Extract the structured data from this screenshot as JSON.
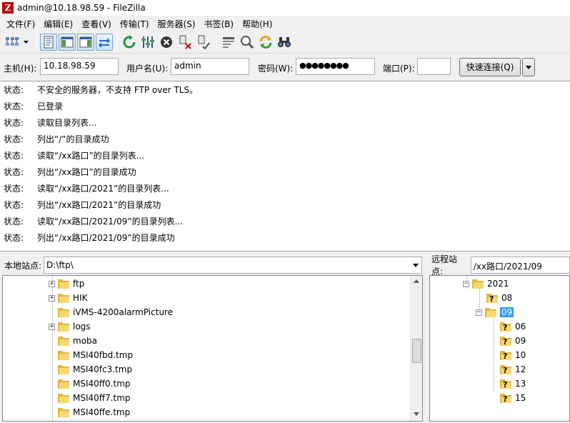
{
  "window": {
    "app_icon": "Z",
    "title": "admin@10.18.98.59 - FileZilla"
  },
  "menu": [
    {
      "label": "文件(F)"
    },
    {
      "label": "编辑(E)"
    },
    {
      "label": "查看(V)"
    },
    {
      "label": "传输(T)"
    },
    {
      "label": "服务器(S)"
    },
    {
      "label": "书签(B)"
    },
    {
      "label": "帮助(H)"
    }
  ],
  "toolbar": {
    "icons": [
      "site-manager-icon",
      "toggle-message-log-icon",
      "toggle-local-tree-icon",
      "toggle-remote-tree-icon",
      "toggle-queue-icon",
      "refresh-icon",
      "process-queue-icon",
      "cancel-icon",
      "disconnect-icon",
      "reconnect-icon",
      "filter-icon",
      "compare-icon",
      "sync-browse-icon",
      "search-icon"
    ]
  },
  "quickconnect": {
    "host_label": "主机(H):",
    "host_value": "10.18.98.59",
    "user_label": "用户名(U):",
    "user_value": "admin",
    "pass_label": "密码(W):",
    "pass_value": "●●●●●●●●",
    "port_label": "端口(P):",
    "port_value": "",
    "connect_label": "快速连接(Q)"
  },
  "log": [
    {
      "type": "状态:",
      "message": "不安全的服务器，不支持 FTP over TLS。"
    },
    {
      "type": "状态:",
      "message": "已登录"
    },
    {
      "type": "状态:",
      "message": "读取目录列表..."
    },
    {
      "type": "状态:",
      "message": "列出“/”的目录成功"
    },
    {
      "type": "状态:",
      "message": "读取“/xx路口”的目录列表..."
    },
    {
      "type": "状态:",
      "message": "列出“/xx路口”的目录成功"
    },
    {
      "type": "状态:",
      "message": "读取“/xx路口/2021”的目录列表..."
    },
    {
      "type": "状态:",
      "message": "列出“/xx路口/2021”的目录成功"
    },
    {
      "type": "状态:",
      "message": "读取“/xx路口/2021/09”的目录列表..."
    },
    {
      "type": "状态:",
      "message": "列出“/xx路口/2021/09”的目录成功"
    }
  ],
  "local": {
    "site_label": "本地站点:",
    "path": "D:\\ftp\\",
    "tree": [
      {
        "name": "ftp",
        "expander": "+"
      },
      {
        "name": "HIK",
        "expander": "+"
      },
      {
        "name": "iVMS-4200alarmPicture",
        "expander": ""
      },
      {
        "name": "logs",
        "expander": "+"
      },
      {
        "name": "moba",
        "expander": ""
      },
      {
        "name": "MSI40fbd.tmp",
        "expander": ""
      },
      {
        "name": "MSI40fc3.tmp",
        "expander": ""
      },
      {
        "name": "MSI40ff0.tmp",
        "expander": ""
      },
      {
        "name": "MSI40ff7.tmp",
        "expander": ""
      },
      {
        "name": "MSI40ffe.tmp",
        "expander": ""
      }
    ]
  },
  "remote": {
    "site_label": "远程站点:",
    "path": "/xx路口/2021/09",
    "tree": {
      "year": {
        "name": "2021",
        "expander": "−"
      },
      "children": [
        {
          "name": "08"
        },
        {
          "name": "09",
          "expander": "−",
          "selected": true
        }
      ],
      "days": [
        {
          "name": "06"
        },
        {
          "name": "09"
        },
        {
          "name": "10"
        },
        {
          "name": "12"
        },
        {
          "name": "13"
        },
        {
          "name": "15"
        }
      ]
    }
  }
}
